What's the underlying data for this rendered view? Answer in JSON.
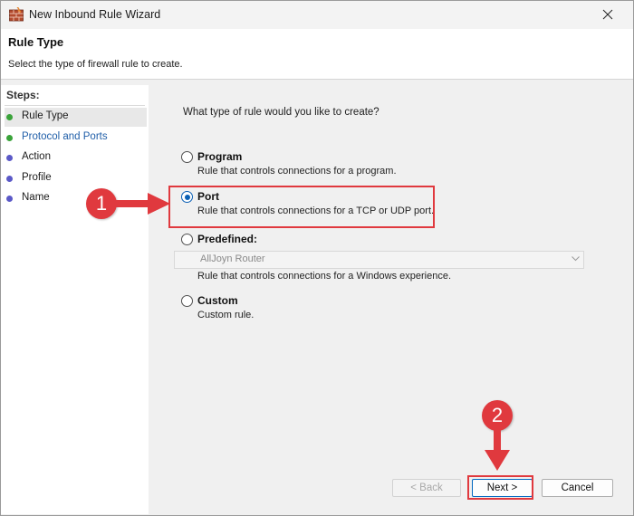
{
  "window": {
    "title": "New Inbound Rule Wizard",
    "icons": {
      "app": "firewall-wall-icon",
      "close": "close-icon"
    }
  },
  "header": {
    "title": "Rule Type",
    "description": "Select the type of firewall rule to create."
  },
  "steps": {
    "title": "Steps:",
    "items": [
      {
        "label": "Rule Type",
        "state": "current",
        "bullet_color": "#3aa33a"
      },
      {
        "label": "Protocol and Ports",
        "state": "next",
        "bullet_color": "#3aa33a",
        "text_color": "#1f5ea8"
      },
      {
        "label": "Action",
        "state": "pending",
        "bullet_color": "#5b59c7"
      },
      {
        "label": "Profile",
        "state": "pending",
        "bullet_color": "#5b59c7"
      },
      {
        "label": "Name",
        "state": "pending",
        "bullet_color": "#5b59c7"
      }
    ]
  },
  "main": {
    "question": "What type of rule would you like to create?",
    "options": [
      {
        "label": "Program",
        "description": "Rule that controls connections for a program.",
        "selected": false
      },
      {
        "label": "Port",
        "description": "Rule that controls connections for a TCP or UDP port.",
        "selected": true
      },
      {
        "label": "Predefined:",
        "description": "Rule that controls connections for a Windows experience.",
        "selected": false
      },
      {
        "label": "Custom",
        "description": "Custom rule.",
        "selected": false
      }
    ],
    "predefined_dropdown": {
      "value": "AllJoyn Router",
      "enabled": false
    }
  },
  "buttons": {
    "back": "< Back",
    "next": "Next >",
    "cancel": "Cancel"
  },
  "annotations": {
    "badge_1": "1",
    "badge_2": "2",
    "color": "#e0393e"
  }
}
